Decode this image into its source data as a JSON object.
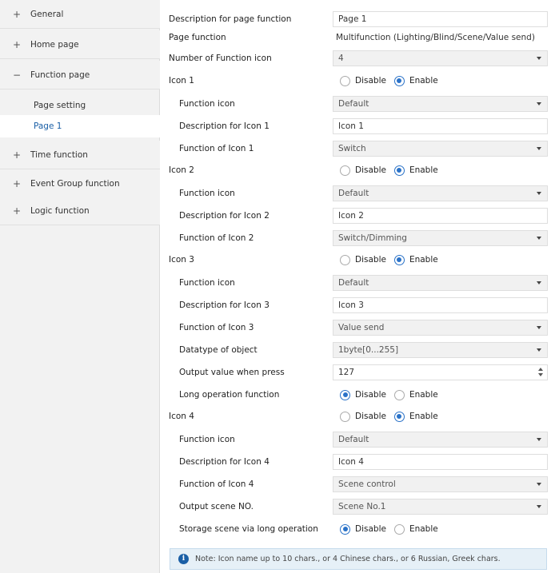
{
  "sidebar": {
    "items": [
      {
        "sign": "+",
        "label": "General"
      },
      {
        "sign": "+",
        "label": "Home page"
      },
      {
        "sign": "−",
        "label": "Function page"
      },
      {
        "sign": "+",
        "label": "Time function"
      },
      {
        "sign": "+",
        "label": "Event Group function"
      },
      {
        "sign": "+",
        "label": "Logic function"
      }
    ],
    "subitems": [
      {
        "label": "Page setting",
        "selected": false
      },
      {
        "label": "Page 1",
        "selected": true
      }
    ],
    "selected_color": "#1a5fa6"
  },
  "main": {
    "description_label": "Description for page function",
    "description_value": "Page 1",
    "page_function_label": "Page function",
    "page_function_value": "Multifunction (Lighting/Blind/Scene/Value send)",
    "num_icons_label": "Number of  Function icon",
    "num_icons_value": "4",
    "disable": "Disable",
    "enable": "Enable",
    "icon1": {
      "title": "Icon 1",
      "function_icon_label": "Function icon",
      "function_icon_value": "Default",
      "desc_label": "Description for Icon 1",
      "desc_value": "Icon 1",
      "func_label": "Function of Icon 1",
      "func_value": "Switch"
    },
    "icon2": {
      "title": "Icon 2",
      "function_icon_label": "Function icon",
      "function_icon_value": "Default",
      "desc_label": "Description for Icon 2",
      "desc_value": "Icon 2",
      "func_label": "Function of Icon 2",
      "func_value": "Switch/Dimming"
    },
    "icon3": {
      "title": "Icon 3",
      "function_icon_label": "Function icon",
      "function_icon_value": "Default",
      "desc_label": "Description for Icon 3",
      "desc_value": "Icon 3",
      "func_label": "Function of Icon 3",
      "func_value": "Value send",
      "datatype_label": "Datatype of object",
      "datatype_value": "1byte[0...255]",
      "output_label": "Output value when press",
      "output_value": "127",
      "long_op_label": "Long operation function"
    },
    "icon4": {
      "title": "Icon 4",
      "function_icon_label": "Function icon",
      "function_icon_value": "Default",
      "desc_label": "Description for Icon 4",
      "desc_value": "Icon 4",
      "func_label": "Function of Icon 4",
      "func_value": "Scene control",
      "scene_label": "Output scene NO.",
      "scene_value": "Scene No.1",
      "storage_label": "Storage scene via long operation"
    },
    "note_icon": "info-icon",
    "note_text": "Note: Icon name up to 10 chars., or 4 Chinese chars., or 6 Russian, Greek chars."
  },
  "colors": {
    "accent": "#2a72c8",
    "note_bg": "#e6f0f7"
  }
}
